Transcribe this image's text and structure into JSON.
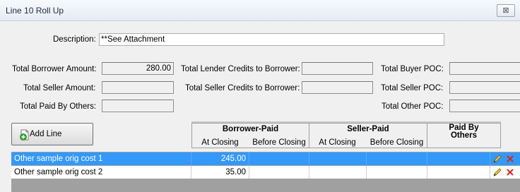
{
  "window": {
    "title": "Line 10 Roll Up",
    "close_glyph": "⊠"
  },
  "description": {
    "label": "Description:",
    "value": "**See Attachment"
  },
  "totals": {
    "borrower_amount_label": "Total Borrower Amount:",
    "borrower_amount_value": "280.00",
    "seller_amount_label": "Total Seller Amount:",
    "seller_amount_value": "",
    "paid_by_others_label": "Total Paid By Others:",
    "paid_by_others_value": "",
    "lender_credits_label": "Total Lender Credits to Borrower:",
    "lender_credits_value": "",
    "seller_credits_label": "Total Seller Credits to Borrower:",
    "seller_credits_value": "",
    "buyer_poc_label": "Total Buyer POC:",
    "buyer_poc_value": "",
    "seller_poc_label": "Total Seller POC:",
    "seller_poc_value": "",
    "other_poc_label": "Total Other POC:",
    "other_poc_value": ""
  },
  "toolbar": {
    "add_line_label": "Add Line",
    "add_icon": "add-document-icon"
  },
  "columns": {
    "borrower_paid": "Borrower-Paid",
    "seller_paid": "Seller-Paid",
    "paid_by_others": "Paid By\nOthers",
    "at_closing": "At Closing",
    "before_closing": "Before Closing"
  },
  "rows": [
    {
      "name": "Other sample orig cost 1",
      "borrower_at_closing": "245.00",
      "borrower_before_closing": "",
      "seller_at_closing": "",
      "seller_before_closing": "",
      "paid_by_others": "",
      "selected": true
    },
    {
      "name": "Other sample orig cost 2",
      "borrower_at_closing": "35.00",
      "borrower_before_closing": "",
      "seller_at_closing": "",
      "seller_before_closing": "",
      "paid_by_others": "",
      "selected": false
    }
  ],
  "row_icons": {
    "edit": "pencil-icon",
    "delete": "delete-x-icon"
  },
  "colors": {
    "selection": "#3399ff",
    "delete": "#d9261c"
  }
}
